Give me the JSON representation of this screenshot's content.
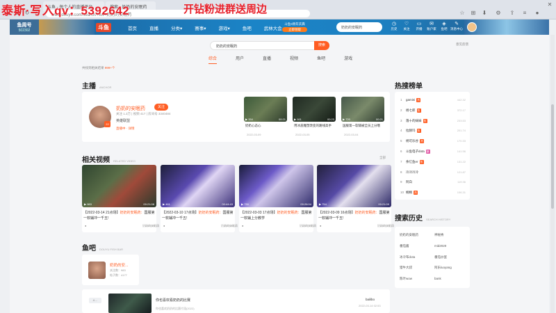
{
  "overlay": {
    "left_text": "泰斯·写入qv：5392642",
    "right_text": "开钻粉进群送周边"
  },
  "browser": {
    "tabs": [
      "斗鱼 - 每个人的直播平台",
      "搜索 - 奶奶的安眠药"
    ],
    "address": "www.douyu.com/search/?kw=奶奶的安眠药"
  },
  "header": {
    "logo_main": "鱼周号",
    "logo_sub": "502302",
    "brand": "斗鱼",
    "nav": [
      "首页",
      "直播",
      "分类▾",
      "赛事▾",
      "游戏▾",
      "鱼吧",
      "武林大会"
    ],
    "promo_top": "斗鱼3周年庆典",
    "promo_btn": "立即领取",
    "search_value": "奶奶的安眠药",
    "icons": [
      {
        "glyph": "◷",
        "label": "历史"
      },
      {
        "glyph": "♡",
        "label": "关注"
      },
      {
        "glyph": "▭",
        "label": "开播"
      },
      {
        "glyph": "✉",
        "label": "账户家"
      },
      {
        "glyph": "◈",
        "label": "鱼吧"
      },
      {
        "glyph": "✎",
        "label": "消息中心"
      }
    ]
  },
  "search": {
    "value": "奶奶的安眠药",
    "button": "搜索",
    "feedback": "意见反馈",
    "tabs": [
      "综合",
      "用户",
      "直播",
      "视频",
      "鱼吧",
      "游戏"
    ],
    "active_tab": 0,
    "hint_prefix": "共找到相关结果",
    "hint_count": "999+个"
  },
  "streamer": {
    "section_title": "主播",
    "section_sub": "ANCHOR",
    "name": "奶奶的安眠药",
    "follow": "关注",
    "meta": "关注 1.3万 | 视频 417 | 房间号 3340484",
    "category": "英雄联盟",
    "room": "直播中 · 详情",
    "level": "22",
    "videos": [
      {
        "views": "334",
        "duration": "00:21",
        "title": "奶奶心态心",
        "date": "2022-03-09"
      },
      {
        "views": "161",
        "duration": "00:23",
        "title": "用冰盖雕塑改变的路线高手",
        "date": "2022-03-05"
      },
      {
        "views": "720",
        "duration": "00:21",
        "title": "国服第一软辅被全员上分哦",
        "date": "2022-03-04"
      }
    ]
  },
  "related": {
    "section_title": "相关视频",
    "section_sub": "RELATED VIDEO",
    "more": "全部",
    "items": [
      {
        "prefix": "【2022-03-14 21点场】",
        "hl": "奶奶的安眠药：",
        "rest": "国服第一软辅冲一千五!",
        "author": "奶奶的安眠药",
        "date": "2022-03-15",
        "views": "983",
        "duration": "00:21:08"
      },
      {
        "prefix": "【2022-03-10 17点场】",
        "hl": "奶奶的安眠药：",
        "rest": "国服第一软辅冲一千五!",
        "author": "奶奶的安眠药",
        "date": "2022-03-11",
        "views": "461",
        "duration": "00:44:43"
      },
      {
        "prefix": "【2022-03-03 17点场】",
        "hl": "奶奶的安眠药：",
        "rest": "国服第一软辅上分教学",
        "author": "奶奶的安眠药",
        "date": "2022-03-04",
        "views": "730",
        "duration": "00:26:04"
      },
      {
        "prefix": "【2022-03-09 16点场】",
        "hl": "奶奶的安眠药：",
        "rest": "国服第一软辅冲一千五!",
        "author": "奶奶的安眠药",
        "date": "2022-03-10",
        "views": "754",
        "duration": "00:21:09"
      }
    ]
  },
  "fishbar": {
    "section_title": "鱼吧",
    "section_sub": "DOUYU FISH BAR",
    "name": "奶奶的安...",
    "line1": "关注数：983",
    "line2": "帖子数：4177"
  },
  "bottom": {
    "tag": "4 ...",
    "title": "你也喜欢看奶奶的比赛",
    "desc": "你也喜欢奶奶的比赛片段(2022)",
    "author": "bailibo",
    "date": "2022-03-14 02:53"
  },
  "hot": {
    "title": "热搜榜单",
    "items": [
      {
        "n": "1",
        "t": "gamini",
        "badge": "热",
        "v": "442.32"
      },
      {
        "n": "2",
        "t": "杨七郎",
        "badge": "热",
        "v": "372.17"
      },
      {
        "n": "3",
        "t": "落十的妹妹",
        "badge": "热",
        "v": "233.53"
      },
      {
        "n": "4",
        "t": "拉赫玛",
        "badge": "热",
        "v": "201.74"
      },
      {
        "n": "5",
        "t": "杨可乐谷",
        "badge": "热",
        "v": "170.33"
      },
      {
        "n": "6",
        "t": "斗鱼电子dota",
        "badge": "新",
        "v": "141.56"
      },
      {
        "n": "7",
        "t": "余亿鱼er",
        "badge": "热",
        "v": "131.22"
      },
      {
        "n": "8",
        "t": "冷冷冷冷",
        "badge": "",
        "v": "121.87"
      },
      {
        "n": "9",
        "t": "阿白",
        "badge": "",
        "v": "119.36"
      },
      {
        "n": "10",
        "t": "桐桐",
        "badge": "热",
        "v": "106.31"
      }
    ]
  },
  "history": {
    "title": "搜索历史",
    "section_sub": "SEARCH HISTORY",
    "items": [
      "奶奶的安眠药",
      "神秘秀",
      "番茄酱",
      "mid2020",
      "冰冷布dota",
      "番茄炒蛋",
      "猎牛大叔",
      "阿乐luoyang",
      "陈叶wow",
      "bank"
    ]
  }
}
